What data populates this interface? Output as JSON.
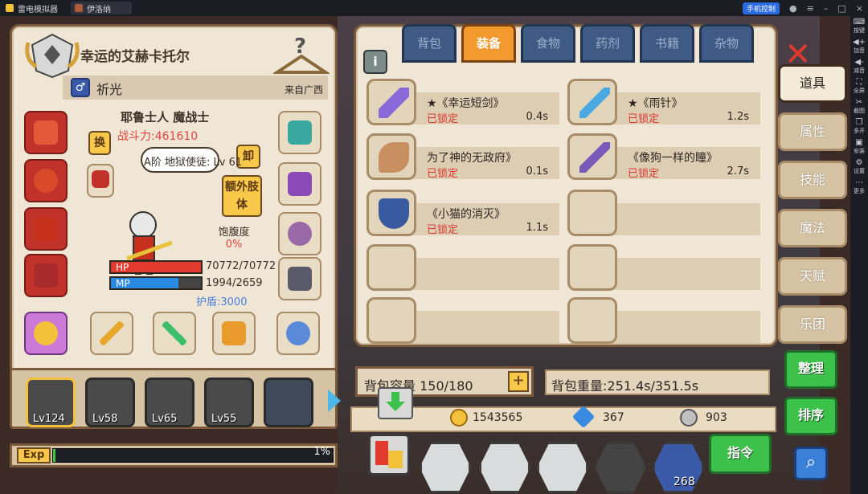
{
  "window": {
    "tabs": [
      {
        "label": "雷电模拟器"
      },
      {
        "label": "伊洛纳"
      }
    ],
    "phone_control": "手机控制"
  },
  "right_sidebar": {
    "items": [
      {
        "label": "按键"
      },
      {
        "label": "加音"
      },
      {
        "label": "减音"
      },
      {
        "label": "全屏"
      },
      {
        "label": "截图"
      },
      {
        "label": "多开"
      },
      {
        "label": "安装"
      },
      {
        "label": "设置"
      },
      {
        "label": "更多"
      }
    ]
  },
  "character": {
    "name": "幸运的艾赫卡托尔",
    "gender_symbol": "♂",
    "title": "祈光",
    "origin": "来自广西",
    "class": "耶鲁士人 魔战士",
    "power": "战斗力:461610",
    "rank": "A阶 地狱使徒: Lv 61",
    "hunger_label": "饱腹度",
    "hunger_value": "0%",
    "hp_label": "HP",
    "hp_value": "70772/70772",
    "hp_fraction": 1.0,
    "mp_label": "MP",
    "mp_value": "1994/2659",
    "mp_fraction": 0.75,
    "shield": "护盾:3000",
    "swap_btn": "换",
    "unequip_btn": "卸",
    "extra_limb_btn": "额外肢体"
  },
  "party": [
    {
      "level": "Lv124",
      "active": true
    },
    {
      "level": "Lv58",
      "active": false
    },
    {
      "level": "Lv65",
      "active": false
    },
    {
      "level": "Lv55",
      "active": false
    },
    {
      "level": "",
      "active": false
    }
  ],
  "exp": {
    "label": "Exp",
    "percent": "1%",
    "fraction": 0.01
  },
  "inventory": {
    "tabs": [
      {
        "label": "背包",
        "active": false
      },
      {
        "label": "装备",
        "active": true
      },
      {
        "label": "食物",
        "active": false
      },
      {
        "label": "药剂",
        "active": false
      },
      {
        "label": "书籍",
        "active": false
      },
      {
        "label": "杂物",
        "active": false
      }
    ],
    "info_btn": "i",
    "items": [
      {
        "name": "★《幸运短剑》",
        "status": "已锁定",
        "weight": "0.4s",
        "icon": "dagger-icon",
        "color": "#8a6ad8"
      },
      {
        "name": "★《雨针》",
        "status": "已锁定",
        "weight": "1.2s",
        "icon": "spear-icon",
        "color": "#4aa8e0"
      },
      {
        "name": "为了神的无政府》",
        "status": "已锁定",
        "weight": "0.1s",
        "icon": "horn-icon",
        "color": "#c89060"
      },
      {
        "name": "《像狗一样的瞳》",
        "status": "已锁定",
        "weight": "2.7s",
        "icon": "blade-icon",
        "color": "#7a5ab8"
      },
      {
        "name": "《小猫的消灭》",
        "status": "已锁定",
        "weight": "1.1s",
        "icon": "shield-item-icon",
        "color": "#3a5aa0"
      }
    ],
    "capacity": "背包容量 150/180",
    "capacity_plus": "+",
    "weight": "背包重量:251.4s/351.5s"
  },
  "currency": {
    "gold": "1543565",
    "gems": "367",
    "silver": "903"
  },
  "side_tabs": [
    {
      "label": "道具",
      "active": true
    },
    {
      "label": "属性",
      "active": false
    },
    {
      "label": "技能",
      "active": false
    },
    {
      "label": "魔法",
      "active": false
    },
    {
      "label": "天赋",
      "active": false
    },
    {
      "label": "乐团",
      "active": false
    }
  ],
  "actions": {
    "sort": "整理",
    "order": "排序",
    "command": "指令",
    "scroll_count": "268"
  }
}
